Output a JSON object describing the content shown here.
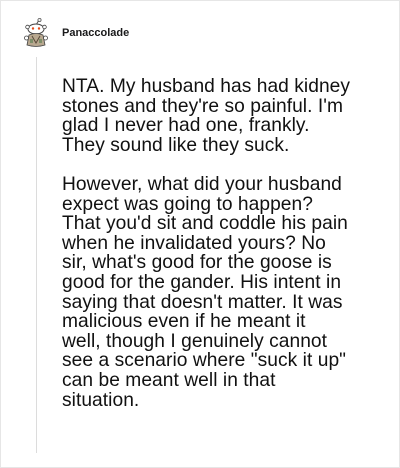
{
  "comment": {
    "author": "Panaccolade",
    "avatar_icon": "snoo-avatar-icon",
    "paragraphs": [
      "NTA. My husband has had kidney\nstones and they're so painful. I'm\nglad I never had one, frankly.\nThey sound like they suck.",
      "However, what did your husband\nexpect was going to happen?\nThat you'd sit and coddle his pain\nwhen he invalidated yours? No\nsir, what's good for the goose is\ngood for the gander. His intent in\nsaying that doesn't matter. It was\nmalicious even if he meant it\nwell, though I genuinely cannot\nsee a scenario where \"suck it up\"\ncan be meant well in that\nsituation."
    ]
  },
  "colors": {
    "text": "#111111",
    "thread_line": "#dcdcdc",
    "background": "#ffffff"
  }
}
